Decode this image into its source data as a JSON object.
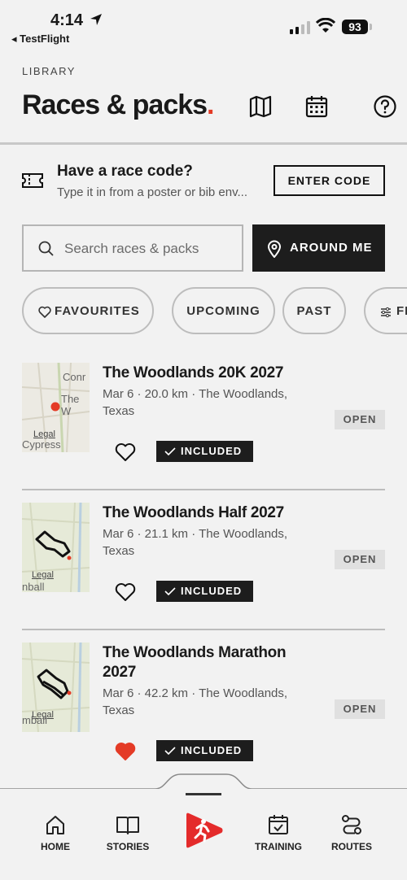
{
  "status_bar": {
    "time": "4:14",
    "back_app": "◂ TestFlight",
    "battery": "93"
  },
  "header": {
    "eyebrow": "LIBRARY",
    "title": "Races & packs",
    "title_dot": "."
  },
  "race_code": {
    "title": "Have a race code?",
    "subtitle": "Type it in from a poster or bib env...",
    "button_label": "ENTER CODE"
  },
  "search": {
    "placeholder": "Search races & packs",
    "value": "",
    "around_me_label": "AROUND ME"
  },
  "filters": [
    {
      "label": "FAVOURITES"
    },
    {
      "label": "UPCOMING"
    },
    {
      "label": "PAST"
    },
    {
      "label": "FI"
    }
  ],
  "races": [
    {
      "title": "The Woodlands 20K 2027",
      "meta": "Mar 6 · 20.0 km · The Woodlands, Texas",
      "status": "OPEN",
      "included": "INCLUDED",
      "favourited": false,
      "map_labels": {
        "top": "Conr",
        "mid": "The W",
        "legal": "Legal",
        "bottom": "Cypress"
      }
    },
    {
      "title": "The Woodlands Half 2027",
      "meta": "Mar 6 · 21.1 km · The Woodlands, Texas",
      "status": "OPEN",
      "included": "INCLUDED",
      "favourited": false,
      "map_labels": {
        "legal": "Legal",
        "bottom": "nball"
      }
    },
    {
      "title": "The Woodlands Marathon 2027",
      "meta": "Mar 6 · 42.2 km · The Woodlands, Texas",
      "status": "OPEN",
      "included": "INCLUDED",
      "favourited": true,
      "map_labels": {
        "legal": "Legal",
        "bottom": "mball"
      }
    }
  ],
  "tabbar": {
    "items": [
      {
        "label": "HOME",
        "icon": "home-icon"
      },
      {
        "label": "STORIES",
        "icon": "book-icon"
      },
      {
        "label": "",
        "icon": "play-runner-icon"
      },
      {
        "label": "TRAINING",
        "icon": "calendar-check-icon"
      },
      {
        "label": "ROUTES",
        "icon": "route-icon"
      }
    ]
  },
  "colors": {
    "accent": "#e43b26",
    "dark": "#1d1d1d",
    "background": "#f2f2f2",
    "heart_active": "#e43b26"
  }
}
